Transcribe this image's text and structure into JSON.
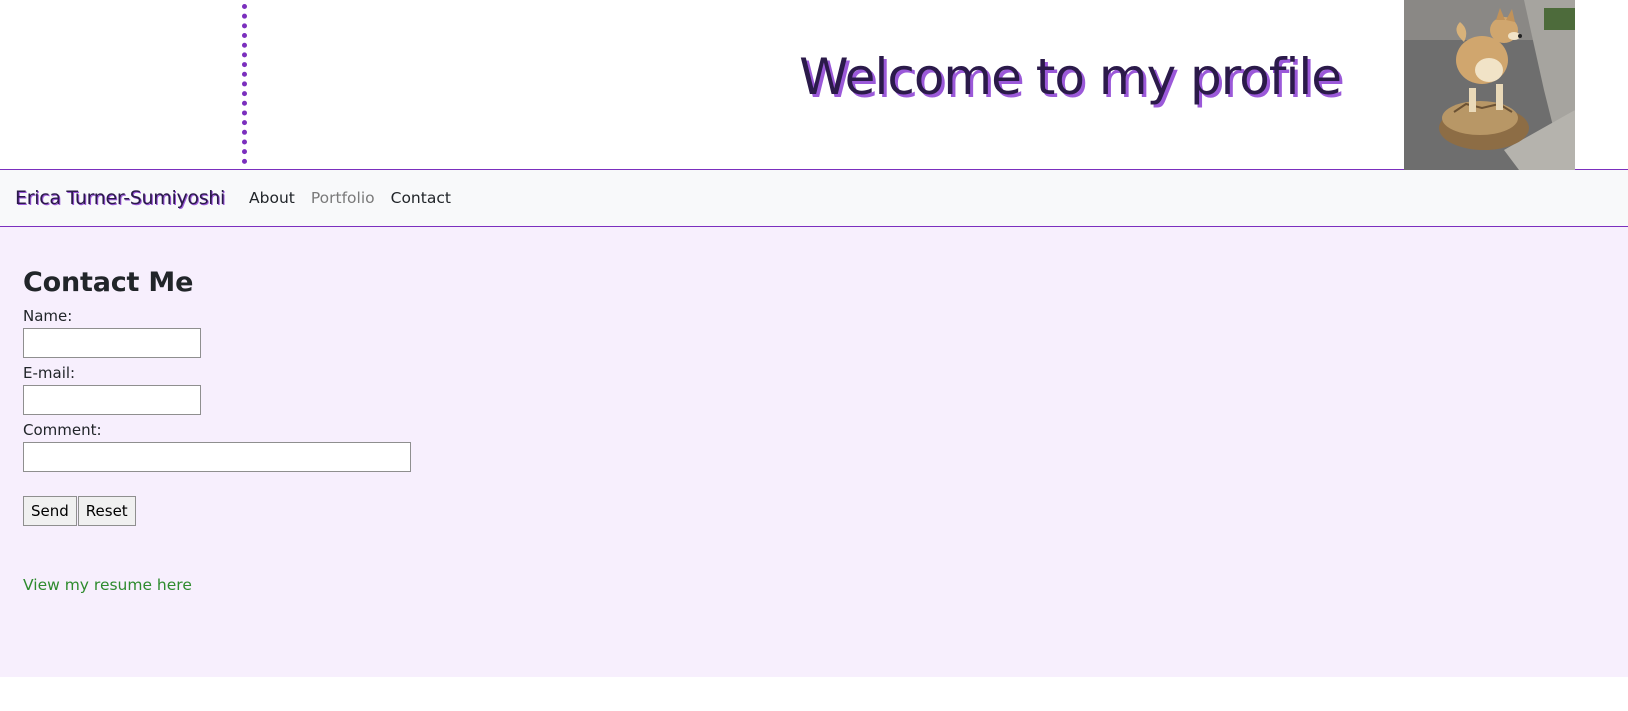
{
  "header": {
    "title": "Welcome to my profile",
    "photo_alt": "Shiba dog standing on a tortoise"
  },
  "nav": {
    "brand": "Erica Turner-Sumiyoshi",
    "links": [
      "About",
      "Portfolio",
      "Contact"
    ]
  },
  "contact": {
    "heading": "Contact Me",
    "name_label": "Name:",
    "email_label": "E-mail:",
    "comment_label": "Comment:",
    "name_value": "",
    "email_value": "",
    "comment_value": "",
    "send_label": "Send",
    "reset_label": "Reset",
    "resume_link": "View my resume here"
  },
  "colors": {
    "accent": "#7b2fbe",
    "title_text": "#2b1a4a",
    "main_bg": "#f7effd",
    "link_green": "#2e8b2e"
  }
}
